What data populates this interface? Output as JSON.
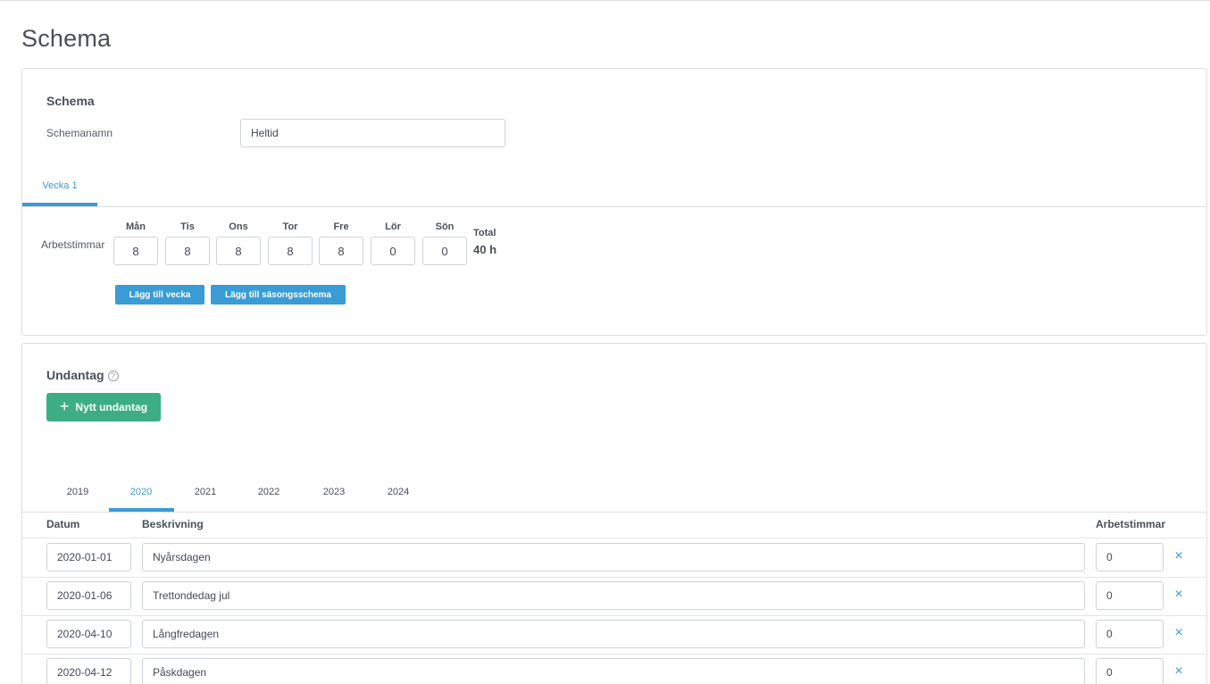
{
  "page": {
    "title": "Schema"
  },
  "schema": {
    "section_title": "Schema",
    "name_label": "Schemanamn",
    "name_value": "Heltid",
    "tabs": [
      {
        "label": "Vecka 1",
        "active": true
      }
    ],
    "hours_label": "Arbetstimmar",
    "days": [
      {
        "label": "Mån",
        "value": "8"
      },
      {
        "label": "Tis",
        "value": "8"
      },
      {
        "label": "Ons",
        "value": "8"
      },
      {
        "label": "Tor",
        "value": "8"
      },
      {
        "label": "Fre",
        "value": "8"
      },
      {
        "label": "Lör",
        "value": "0"
      },
      {
        "label": "Sön",
        "value": "0"
      }
    ],
    "total_label": "Total",
    "total_value": "40 h",
    "add_week_label": "Lägg till vecka",
    "add_season_label": "Lägg till säsongsschema"
  },
  "exceptions": {
    "section_title": "Undantag",
    "help_icon": "?",
    "new_button_label": "Nytt undantag",
    "years": [
      {
        "label": "2019",
        "active": false
      },
      {
        "label": "2020",
        "active": true
      },
      {
        "label": "2021",
        "active": false
      },
      {
        "label": "2022",
        "active": false
      },
      {
        "label": "2023",
        "active": false
      },
      {
        "label": "2024",
        "active": false
      }
    ],
    "columns": {
      "date": "Datum",
      "description": "Beskrivning",
      "hours": "Arbetstimmar"
    },
    "rows": [
      {
        "date": "2020-01-01",
        "description": "Nyårsdagen",
        "hours": "0"
      },
      {
        "date": "2020-01-06",
        "description": "Trettondedag jul",
        "hours": "0"
      },
      {
        "date": "2020-04-10",
        "description": "Långfredagen",
        "hours": "0"
      },
      {
        "date": "2020-04-12",
        "description": "Påskdagen",
        "hours": "0"
      }
    ],
    "delete_icon": "×"
  },
  "colors": {
    "accent": "#3a9bd5",
    "success": "#3dae83",
    "border": "#dcdfe3"
  }
}
